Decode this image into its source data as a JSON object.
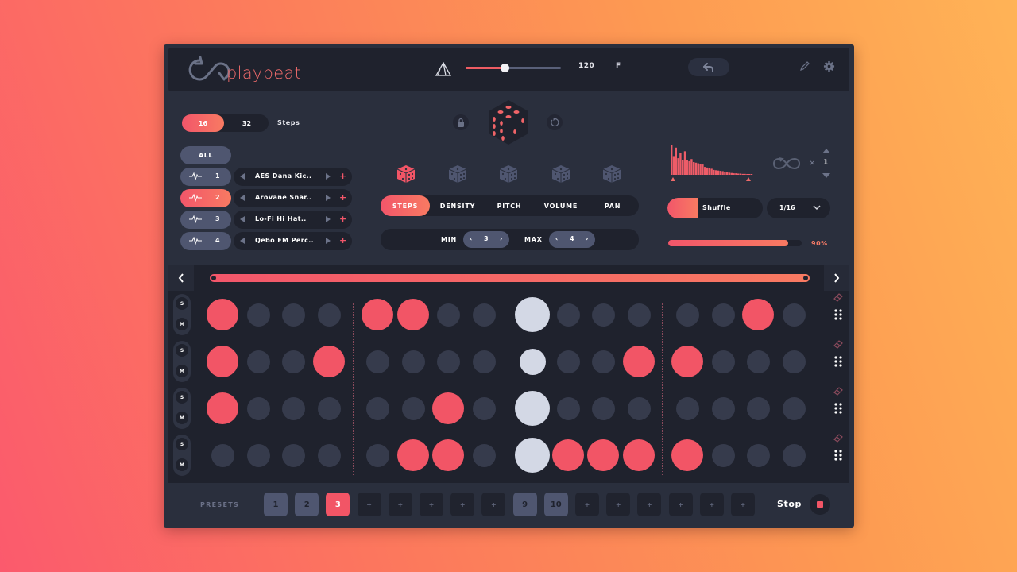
{
  "app": {
    "name": "playbeat"
  },
  "header": {
    "tempo": "120",
    "tempo_fraction": 0.41,
    "key": "F",
    "undo_icon": "undo-icon",
    "pencil_icon": "pencil-icon",
    "settings_icon": "gear-icon",
    "triangle_icon": "prism-triangle-icon"
  },
  "steps": {
    "options": [
      "16",
      "32"
    ],
    "selected": "16",
    "label": "Steps"
  },
  "tracks": {
    "all_label": "ALL",
    "items": [
      {
        "num": "1",
        "sample": "AES Dana Kic..",
        "active": false
      },
      {
        "num": "2",
        "sample": "Arovane Snar..",
        "active": true
      },
      {
        "num": "3",
        "sample": "Lo-Fi Hi Hat..",
        "active": false
      },
      {
        "num": "4",
        "sample": "Qebo FM Perc..",
        "active": false
      }
    ],
    "add_symbol": "+"
  },
  "randomize": {
    "lock_icon": "lock-icon",
    "reset_icon": "reset-icon",
    "dice_icon": "dice-icon",
    "mode_dice_active": 0,
    "modes": [
      "STEPS",
      "DENSITY",
      "PITCH",
      "VOLUME",
      "PAN"
    ],
    "active_mode": "STEPS",
    "min_label": "MIN",
    "min_value": "3",
    "max_label": "MAX",
    "max_value": "4"
  },
  "right_panel": {
    "histogram": [
      1.0,
      0.62,
      0.9,
      0.55,
      0.72,
      0.5,
      0.78,
      0.48,
      0.45,
      0.52,
      0.42,
      0.4,
      0.38,
      0.36,
      0.34,
      0.26,
      0.24,
      0.22,
      0.2,
      0.16,
      0.15,
      0.14,
      0.13,
      0.12,
      0.1,
      0.08,
      0.07,
      0.06,
      0.05,
      0.05,
      0.04,
      0.04,
      0.03,
      0.03,
      0.02,
      0.02,
      0.02
    ],
    "loop_count_prefix": "×",
    "loop_count": "1",
    "shuffle_label": "Shuffle",
    "rate": "1/16",
    "swing_percent": 90,
    "swing_label": "90%"
  },
  "sequencer": {
    "solo_label": "S",
    "mute_label": "M",
    "playhead_column": 8,
    "rows": [
      [
        1,
        0,
        0,
        0,
        1,
        1,
        0,
        0,
        0,
        0,
        0,
        0,
        0,
        0,
        1,
        0
      ],
      [
        1,
        0,
        0,
        1,
        0,
        0,
        0,
        0,
        0,
        0,
        0,
        1,
        1,
        0,
        0,
        0
      ],
      [
        1,
        0,
        0,
        0,
        0,
        0,
        1,
        0,
        0,
        0,
        0,
        0,
        0,
        0,
        0,
        0
      ],
      [
        0,
        0,
        0,
        0,
        0,
        1,
        1,
        0,
        0,
        1,
        1,
        1,
        1,
        0,
        0,
        0
      ]
    ],
    "playhead_small_rows": [
      1
    ]
  },
  "footer": {
    "presets_label": "PRESETS",
    "presets": [
      {
        "label": "1",
        "state": "filled"
      },
      {
        "label": "2",
        "state": "filled"
      },
      {
        "label": "3",
        "state": "active"
      },
      {
        "label": "+",
        "state": "empty"
      },
      {
        "label": "+",
        "state": "empty"
      },
      {
        "label": "+",
        "state": "empty"
      },
      {
        "label": "+",
        "state": "empty"
      },
      {
        "label": "+",
        "state": "empty"
      },
      {
        "label": "9",
        "state": "filled"
      },
      {
        "label": "10",
        "state": "filled"
      },
      {
        "label": "+",
        "state": "empty"
      },
      {
        "label": "+",
        "state": "empty"
      },
      {
        "label": "+",
        "state": "empty"
      },
      {
        "label": "+",
        "state": "empty"
      },
      {
        "label": "+",
        "state": "empty"
      },
      {
        "label": "+",
        "state": "empty"
      }
    ],
    "stop_label": "Stop"
  },
  "colors": {
    "accent": "#f25566",
    "accent_end": "#f87a62",
    "panel": "#2a2f3d",
    "panel_dark": "#1f222d",
    "step_off": "#363b4c",
    "playhead": "#d3d8e5"
  }
}
